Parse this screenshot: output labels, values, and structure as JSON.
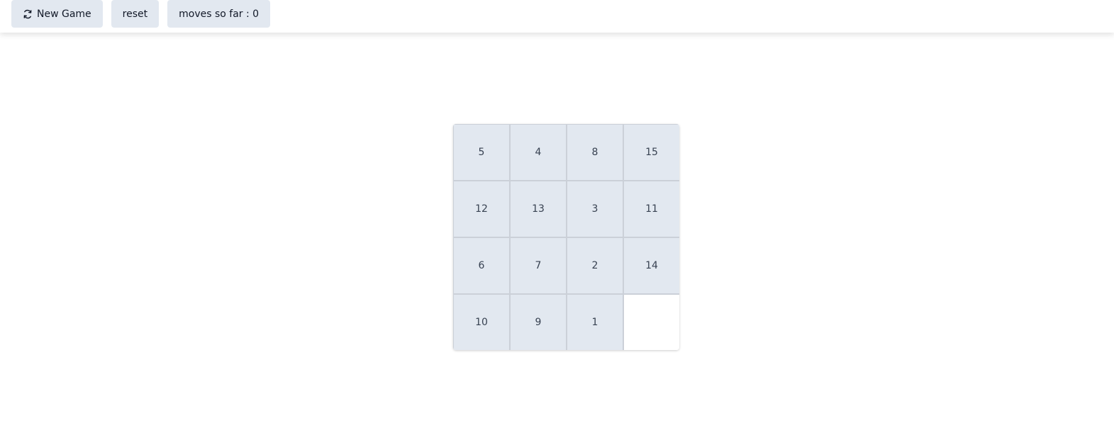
{
  "toolbar": {
    "new_game_label": "New Game",
    "new_game_icon": "refresh-icon",
    "reset_label": "reset",
    "moves_label": "moves so far : 0",
    "moves_count": 0
  },
  "board": {
    "size": 4,
    "tiles": [
      "5",
      "4",
      "8",
      "15",
      "12",
      "13",
      "3",
      "11",
      "6",
      "7",
      "2",
      "14",
      "10",
      "9",
      "1",
      ""
    ],
    "tile_color": "#e2e8f0",
    "empty_color": "#ffffff"
  }
}
